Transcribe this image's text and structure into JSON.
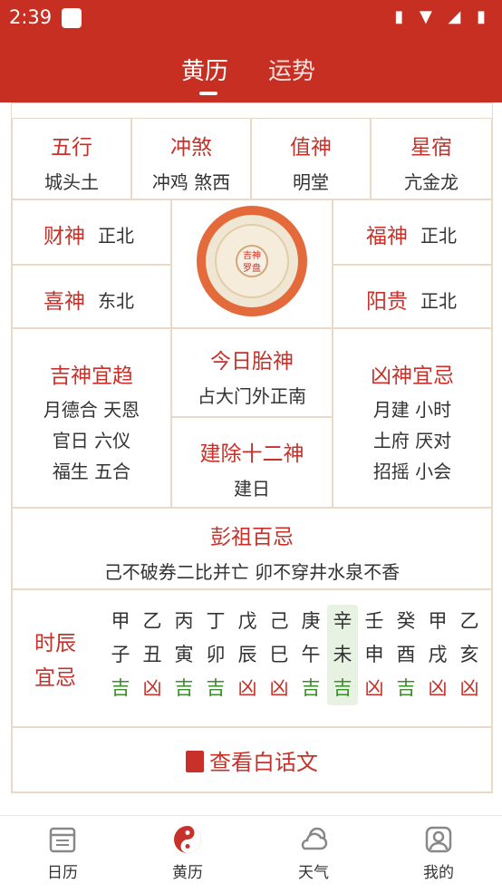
{
  "status_bar": {
    "time": "2:39"
  },
  "header": {
    "tab_active": "黄历",
    "tab_inactive": "运势"
  },
  "grid_top": [
    {
      "label": "五行",
      "value": "城头土"
    },
    {
      "label": "冲煞",
      "value": "冲鸡 煞西"
    },
    {
      "label": "值神",
      "value": "明堂"
    },
    {
      "label": "星宿",
      "value": "亢金龙"
    }
  ],
  "gods": {
    "cai": {
      "label": "财神",
      "value": "正北"
    },
    "xi": {
      "label": "喜神",
      "value": "东北"
    },
    "fu": {
      "label": "福神",
      "value": "正北"
    },
    "yang": {
      "label": "阳贵",
      "value": "正北"
    }
  },
  "compass": {
    "line1": "吉神",
    "line2": "罗盘"
  },
  "auspicious": {
    "title": "吉神宜趋",
    "lines": [
      "月德合 天恩",
      "官日 六仪",
      "福生 五合"
    ]
  },
  "inauspicious": {
    "title": "凶神宜忌",
    "lines": [
      "月建 小时",
      "土府 厌对",
      "招摇 小会"
    ]
  },
  "fetal": {
    "title": "今日胎神",
    "value": "占大门外正南"
  },
  "twelve": {
    "title": "建除十二神",
    "value": "建日"
  },
  "pengzu": {
    "title": "彭祖百忌",
    "value": "己不破券二比并亡 卯不穿井水泉不香"
  },
  "hours": {
    "title_line1": "时辰",
    "title_line2": "宜忌",
    "columns": [
      {
        "stem": "甲",
        "branch": "子",
        "luck": "吉"
      },
      {
        "stem": "乙",
        "branch": "丑",
        "luck": "凶"
      },
      {
        "stem": "丙",
        "branch": "寅",
        "luck": "吉"
      },
      {
        "stem": "丁",
        "branch": "卯",
        "luck": "吉"
      },
      {
        "stem": "戊",
        "branch": "辰",
        "luck": "凶"
      },
      {
        "stem": "己",
        "branch": "巳",
        "luck": "凶"
      },
      {
        "stem": "庚",
        "branch": "午",
        "luck": "吉"
      },
      {
        "stem": "辛",
        "branch": "未",
        "luck": "吉",
        "current": true
      },
      {
        "stem": "壬",
        "branch": "申",
        "luck": "凶"
      },
      {
        "stem": "癸",
        "branch": "酉",
        "luck": "吉"
      },
      {
        "stem": "甲",
        "branch": "戌",
        "luck": "凶"
      },
      {
        "stem": "乙",
        "branch": "亥",
        "luck": "凶"
      }
    ]
  },
  "view_vernacular": "查看白话文",
  "nav": [
    {
      "label": "日历",
      "icon": "calendar-icon"
    },
    {
      "label": "黄历",
      "icon": "yin-yang-icon"
    },
    {
      "label": "天气",
      "icon": "weather-icon"
    },
    {
      "label": "我的",
      "icon": "profile-icon"
    }
  ],
  "colors": {
    "brand": "#c62f22",
    "auspicious": "#3a8b2a",
    "inauspicious": "#c7312a"
  }
}
